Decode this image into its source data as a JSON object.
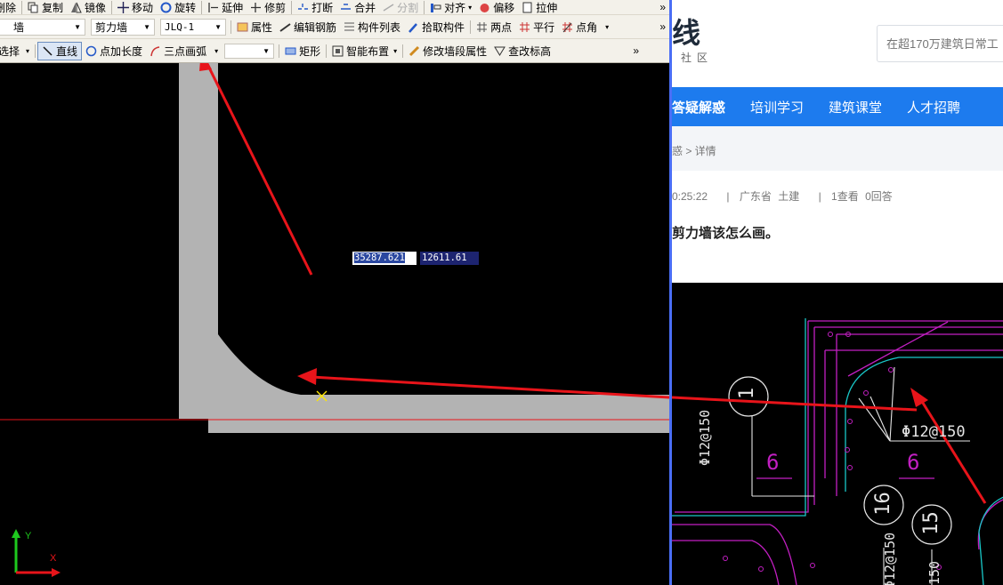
{
  "cad": {
    "toolbar1": {
      "delete": "删除",
      "copy": "复制",
      "mirror": "镜像",
      "move": "移动",
      "rotate": "旋转",
      "extend": "延伸",
      "trim": "修剪",
      "break": "打断",
      "merge": "合并",
      "split": "分割",
      "align": "对齐",
      "offset": "偏移",
      "stretch": "拉伸"
    },
    "toolbar2": {
      "category": "墙",
      "type": "剪力墙",
      "component": "JLQ-1",
      "properties": "属性",
      "edit_rebar": "编辑钢筋",
      "component_list": "构件列表",
      "pick_component": "拾取构件",
      "two_points": "两点",
      "parallel": "平行",
      "point_angle": "点角"
    },
    "toolbar3": {
      "select": "选择",
      "line": "直线",
      "point_length": "点加长度",
      "three_point_arc": "三点画弧",
      "rect": "矩形",
      "smart_layout": "智能布置",
      "modify_wall_segment": "修改墙段属性",
      "check_elevation": "查改标高"
    },
    "coord_x": "35287.621",
    "coord_y": "12611.61",
    "axis_y": "Y",
    "axis_x": "X"
  },
  "web": {
    "logo": "线",
    "logo_sub": "社区",
    "search_placeholder": "在超170万建筑日常工",
    "nav": [
      "答疑解惑",
      "培训学习",
      "建筑课堂",
      "人才招聘"
    ],
    "breadcrumb": "惑 > 详情",
    "meta": {
      "time": "0:25:22",
      "sep1": "|",
      "location": "广东省",
      "discipline": "土建",
      "sep2": "|",
      "views": "1查看",
      "answers": "0回答"
    },
    "question_title": "剪力墙该怎么画。",
    "drawing_labels": {
      "rebar1": "Φ12@150",
      "rebar2": "Φ12@150",
      "rebar3": "Φ12@150",
      "rebar4": "150",
      "num1": "1",
      "num2": "16",
      "num3": "15",
      "dim1": "6",
      "dim2": "6"
    }
  },
  "colors": {
    "toolbar_bg": "#f3f1ea",
    "wall_fill": "#b3b3b3",
    "arrow": "#e8141a",
    "nav_blue": "#1d7bee",
    "drawing_magenta": "#c21fc2",
    "drawing_cyan": "#19c8c8"
  }
}
